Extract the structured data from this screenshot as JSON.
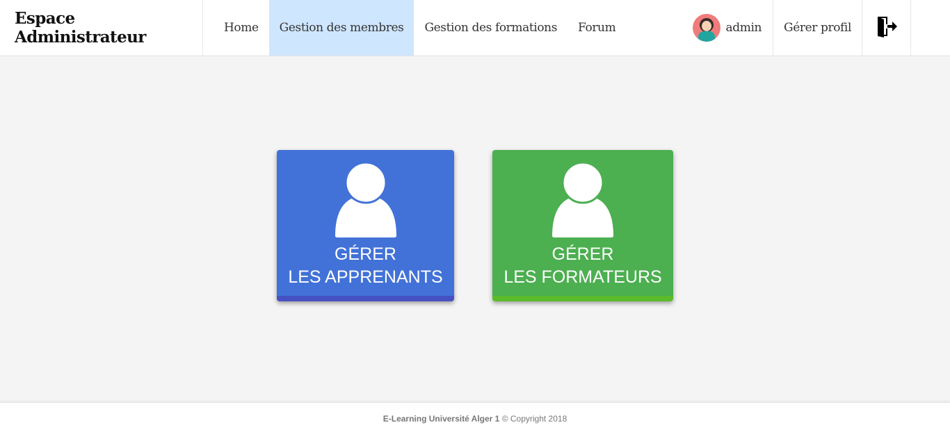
{
  "navbar": {
    "brand": "Espace Administrateur",
    "items": [
      {
        "label": "Home"
      },
      {
        "label": "Gestion des membres"
      },
      {
        "label": "Gestion des formations"
      },
      {
        "label": "Forum"
      }
    ],
    "user_name": "admin",
    "profile_label": "Gérer profil",
    "logout_icon": "logout-icon"
  },
  "tiles": [
    {
      "line1": "GÉRER",
      "line2": "LES APPRENANTS",
      "color": "#4272d7",
      "icon": "user-icon"
    },
    {
      "line1": "GÉRER",
      "line2": "LES FORMATEURS",
      "color": "#4caf50",
      "icon": "user-icon"
    }
  ],
  "footer": {
    "brand": "E-Learning Université Alger 1",
    "copyright": "© Copyright 2018"
  }
}
